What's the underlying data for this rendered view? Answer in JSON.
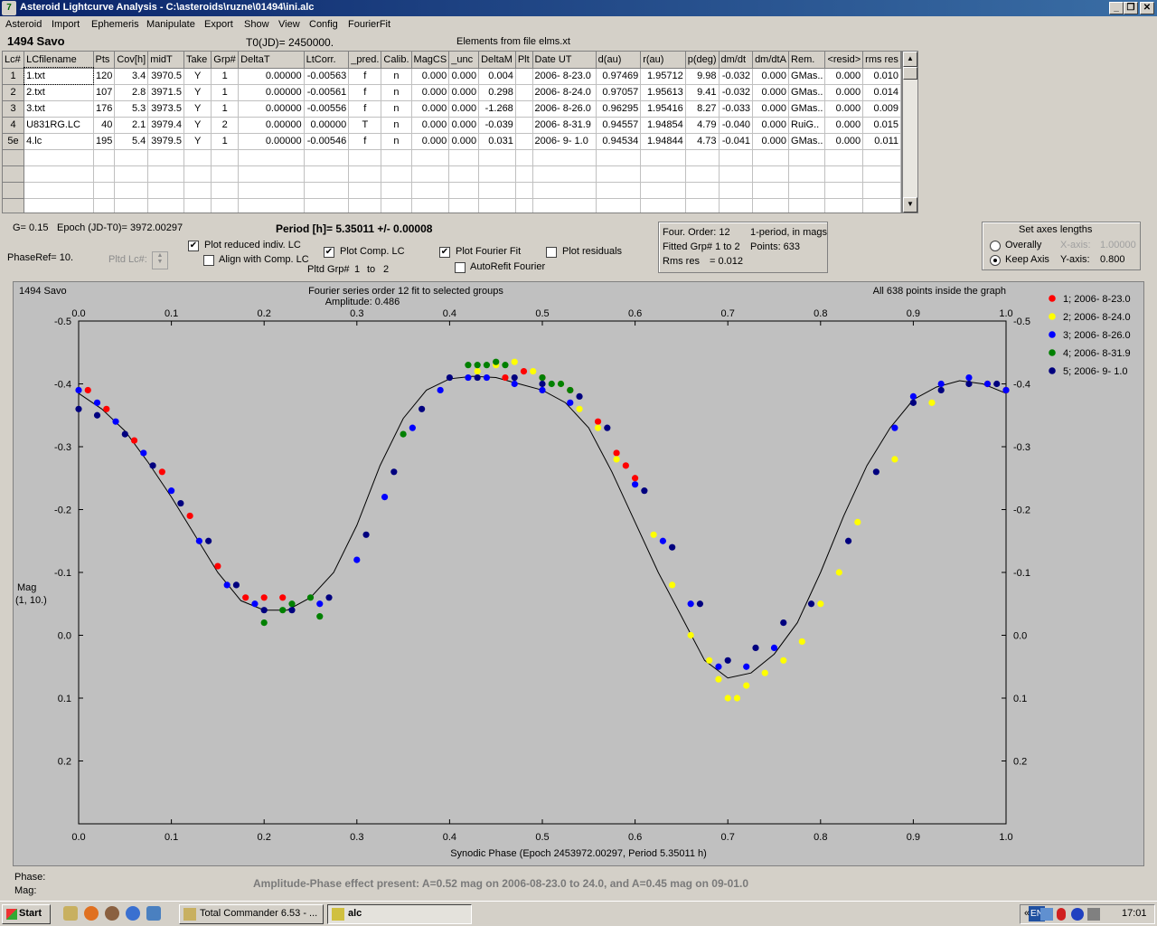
{
  "window": {
    "title": "Asteroid Lightcurve Analysis - C:\\asteroids\\ruzne\\01494\\ini.alc",
    "min": "_",
    "max": "❐",
    "close": "✕"
  },
  "menu": [
    "Asteroid",
    "Import",
    "Ephemeris",
    "Manipulate",
    "Export",
    "Show",
    "View",
    "Config",
    "FourierFit"
  ],
  "header": {
    "asteroid": "1494 Savo",
    "t0": "T0(JD)= 2450000.",
    "elements": "Elements from file elms.xt"
  },
  "table": {
    "columns": [
      "Lc#",
      "LCfilename",
      "Pts",
      "Cov[h]",
      "midT",
      "Take",
      "Grp#",
      "DeltaT",
      "LtCorr.",
      "_pred.",
      "Calib.",
      "MagCS",
      "_unc",
      "DeltaM",
      "Plt",
      "Date UT",
      "d(au)",
      "r(au)",
      "p(deg)",
      "dm/dt",
      "dm/dtA",
      "Rem.",
      "<resid>",
      "rms res"
    ],
    "rows": [
      [
        "1",
        "1.txt",
        "120",
        "3.4",
        "3970.5",
        "Y",
        "1",
        "0.00000",
        "-0.00563",
        "f",
        "n",
        "0.000",
        "0.000",
        "0.004",
        "",
        "2006- 8-23.0",
        "0.97469",
        "1.95712",
        "9.98",
        "-0.032",
        "0.000",
        "GMas..",
        "0.000",
        "0.010"
      ],
      [
        "2",
        "2.txt",
        "107",
        "2.8",
        "3971.5",
        "Y",
        "1",
        "0.00000",
        "-0.00561",
        "f",
        "n",
        "0.000",
        "0.000",
        "0.298",
        "",
        "2006- 8-24.0",
        "0.97057",
        "1.95613",
        "9.41",
        "-0.032",
        "0.000",
        "GMas..",
        "0.000",
        "0.014"
      ],
      [
        "3",
        "3.txt",
        "176",
        "5.3",
        "3973.5",
        "Y",
        "1",
        "0.00000",
        "-0.00556",
        "f",
        "n",
        "0.000",
        "0.000",
        "-1.268",
        "",
        "2006- 8-26.0",
        "0.96295",
        "1.95416",
        "8.27",
        "-0.033",
        "0.000",
        "GMas..",
        "0.000",
        "0.009"
      ],
      [
        "4",
        "U831RG.LC",
        "40",
        "2.1",
        "3979.4",
        "Y",
        "2",
        "0.00000",
        "0.00000",
        "T",
        "n",
        "0.000",
        "0.000",
        "-0.039",
        "",
        "2006- 8-31.9",
        "0.94557",
        "1.94854",
        "4.79",
        "-0.040",
        "0.000",
        "RuiG..",
        "0.000",
        "0.015"
      ],
      [
        "5e",
        "4.lc",
        "195",
        "5.4",
        "3979.5",
        "Y",
        "1",
        "0.00000",
        "-0.00546",
        "f",
        "n",
        "0.000",
        "0.000",
        "0.031",
        "",
        "2006- 9- 1.0",
        "0.94534",
        "1.94844",
        "4.73",
        "-0.041",
        "0.000",
        "GMas..",
        "0.000",
        "0.011"
      ]
    ]
  },
  "params": {
    "g": "G= 0.15",
    "epoch": "Epoch (JD-T0)= 3972.00297",
    "period": "Period [h]= 5.35011 +/- 0.00008",
    "phase_ref": "PhaseRef= 10.",
    "plotted_lc": "Pltd Lc#:",
    "plot_reduced": "Plot reduced indiv. LC",
    "align": "Align with Comp. LC",
    "plot_comp": "Plot Comp. LC",
    "pltd_grp": "Pltd Grp#",
    "grp_from": "1",
    "grp_to_label": "to",
    "grp_to": "2",
    "plot_fourier": "Plot Fourier Fit",
    "autorefit": "AutoRefit Fourier",
    "plot_residuals": "Plot residuals"
  },
  "fourier": {
    "order": "Four. Order: 12",
    "period_in_mags": "1-period, in mags",
    "fitted": "Fitted Grp# 1 to 2",
    "points": "Points: 633",
    "rms": "Rms res",
    "rms_val": "= 0.012"
  },
  "axes_box": {
    "title": "Set axes lengths",
    "overally": "Overally",
    "keep": "Keep Axis",
    "x_label": "X-axis:",
    "x_val": "1.00000",
    "y_label": "Y-axis:",
    "y_val": "0.800"
  },
  "plot": {
    "name": "1494 Savo",
    "fit_title": "Fourier series order 12 fit to selected groups",
    "amplitude": "Amplitude: 0.486",
    "inside": "All 638 points inside the graph",
    "xlabel": "Synodic Phase (Epoch 2453972.00297, Period 5.35011 h)",
    "ylabel1": "Mag",
    "ylabel2": "(1, 10.)"
  },
  "footer": {
    "phase": "Phase:",
    "mag": "Mag:",
    "note": "Amplitude-Phase effect present: A=0.52 mag on 2006-08-23.0 to 24.0, and A=0.45 mag on 09-01.0"
  },
  "taskbar": {
    "start": "Start",
    "items": [
      "Total Commander 6.53 - ...",
      "alc"
    ],
    "lang": "EN",
    "clock": "17:01"
  },
  "chart_data": {
    "type": "scatter",
    "title": "Fourier series order 12 fit to selected groups",
    "xlabel": "Synodic Phase (Epoch 2453972.00297, Period 5.35011 h)",
    "ylabel": "Mag (1, 10.)",
    "xlim": [
      0.0,
      1.0
    ],
    "ylim": [
      -0.5,
      0.3
    ],
    "y_inverted": true,
    "xticks": [
      "0.0",
      "0.1",
      "0.2",
      "0.3",
      "0.4",
      "0.5",
      "0.6",
      "0.7",
      "0.8",
      "0.9",
      "1.0"
    ],
    "yticks": [
      "-0.5",
      "-0.4",
      "-0.3",
      "-0.2",
      "-0.1",
      "0.0",
      "0.1",
      "0.2"
    ],
    "legend_position": "right",
    "fourier_curve": {
      "x": [
        0.0,
        0.025,
        0.05,
        0.075,
        0.1,
        0.125,
        0.15,
        0.175,
        0.2,
        0.225,
        0.25,
        0.275,
        0.3,
        0.325,
        0.35,
        0.375,
        0.4,
        0.425,
        0.45,
        0.475,
        0.5,
        0.525,
        0.55,
        0.575,
        0.6,
        0.625,
        0.65,
        0.675,
        0.7,
        0.725,
        0.75,
        0.775,
        0.8,
        0.825,
        0.85,
        0.875,
        0.9,
        0.925,
        0.95,
        0.975,
        1.0
      ],
      "y": [
        -0.385,
        -0.36,
        -0.325,
        -0.275,
        -0.22,
        -0.16,
        -0.1,
        -0.055,
        -0.04,
        -0.04,
        -0.06,
        -0.1,
        -0.175,
        -0.27,
        -0.345,
        -0.39,
        -0.408,
        -0.412,
        -0.41,
        -0.4,
        -0.39,
        -0.37,
        -0.33,
        -0.26,
        -0.18,
        -0.1,
        -0.03,
        0.04,
        0.068,
        0.06,
        0.03,
        -0.02,
        -0.1,
        -0.19,
        -0.27,
        -0.33,
        -0.375,
        -0.395,
        -0.405,
        -0.4,
        -0.385
      ]
    },
    "series": [
      {
        "name": "1; 2006- 8-23.0",
        "color": "#ff0000",
        "x": [
          0.01,
          0.03,
          0.06,
          0.09,
          0.12,
          0.15,
          0.18,
          0.2,
          0.22,
          0.46,
          0.48,
          0.5,
          0.53,
          0.56,
          0.58,
          0.59,
          0.6,
          0.98,
          1.0
        ],
        "y": [
          -0.39,
          -0.36,
          -0.31,
          -0.26,
          -0.19,
          -0.11,
          -0.06,
          -0.06,
          -0.06,
          -0.41,
          -0.42,
          -0.41,
          -0.39,
          -0.34,
          -0.29,
          -0.27,
          -0.25,
          -0.4,
          -0.39
        ]
      },
      {
        "name": "2; 2006- 8-24.0",
        "color": "#ffff00",
        "x": [
          0.43,
          0.45,
          0.47,
          0.49,
          0.52,
          0.54,
          0.56,
          0.58,
          0.6,
          0.62,
          0.64,
          0.66,
          0.68,
          0.69,
          0.7,
          0.71,
          0.72,
          0.74,
          0.76,
          0.78,
          0.8,
          0.82,
          0.84,
          0.88,
          0.92
        ],
        "y": [
          -0.42,
          -0.43,
          -0.435,
          -0.42,
          -0.4,
          -0.36,
          -0.33,
          -0.28,
          -0.24,
          -0.16,
          -0.08,
          0.0,
          0.04,
          0.07,
          0.1,
          0.1,
          0.08,
          0.06,
          0.04,
          0.01,
          -0.05,
          -0.1,
          -0.18,
          -0.28,
          -0.37
        ]
      },
      {
        "name": "3; 2006- 8-26.0",
        "color": "#0000ff",
        "x": [
          0.0,
          0.02,
          0.04,
          0.07,
          0.1,
          0.13,
          0.16,
          0.19,
          0.26,
          0.3,
          0.33,
          0.36,
          0.39,
          0.42,
          0.44,
          0.47,
          0.5,
          0.53,
          0.6,
          0.63,
          0.66,
          0.69,
          0.72,
          0.75,
          0.88,
          0.9,
          0.93,
          0.96,
          0.98,
          1.0
        ],
        "y": [
          -0.39,
          -0.37,
          -0.34,
          -0.29,
          -0.23,
          -0.15,
          -0.08,
          -0.05,
          -0.05,
          -0.12,
          -0.22,
          -0.33,
          -0.39,
          -0.41,
          -0.41,
          -0.4,
          -0.39,
          -0.37,
          -0.24,
          -0.15,
          -0.05,
          0.05,
          0.05,
          0.02,
          -0.33,
          -0.38,
          -0.4,
          -0.41,
          -0.4,
          -0.39
        ]
      },
      {
        "name": "4; 2006- 8-31.9",
        "color": "#008000",
        "x": [
          0.2,
          0.22,
          0.23,
          0.25,
          0.26,
          0.35,
          0.42,
          0.43,
          0.44,
          0.45,
          0.46,
          0.5,
          0.51,
          0.52,
          0.53
        ],
        "y": [
          -0.02,
          -0.04,
          -0.05,
          -0.06,
          -0.03,
          -0.32,
          -0.43,
          -0.43,
          -0.43,
          -0.435,
          -0.43,
          -0.41,
          -0.4,
          -0.4,
          -0.39
        ]
      },
      {
        "name": "5; 2006- 9- 1.0",
        "color": "#00007f",
        "x": [
          0.0,
          0.02,
          0.05,
          0.08,
          0.11,
          0.14,
          0.17,
          0.2,
          0.23,
          0.27,
          0.31,
          0.34,
          0.37,
          0.4,
          0.43,
          0.47,
          0.5,
          0.54,
          0.57,
          0.61,
          0.64,
          0.67,
          0.7,
          0.73,
          0.76,
          0.79,
          0.83,
          0.86,
          0.9,
          0.93,
          0.96,
          0.99
        ],
        "y": [
          -0.36,
          -0.35,
          -0.32,
          -0.27,
          -0.21,
          -0.15,
          -0.08,
          -0.04,
          -0.04,
          -0.06,
          -0.16,
          -0.26,
          -0.36,
          -0.41,
          -0.41,
          -0.41,
          -0.4,
          -0.38,
          -0.33,
          -0.23,
          -0.14,
          -0.05,
          0.04,
          0.02,
          -0.02,
          -0.05,
          -0.15,
          -0.26,
          -0.37,
          -0.39,
          -0.4,
          -0.4
        ]
      }
    ]
  }
}
